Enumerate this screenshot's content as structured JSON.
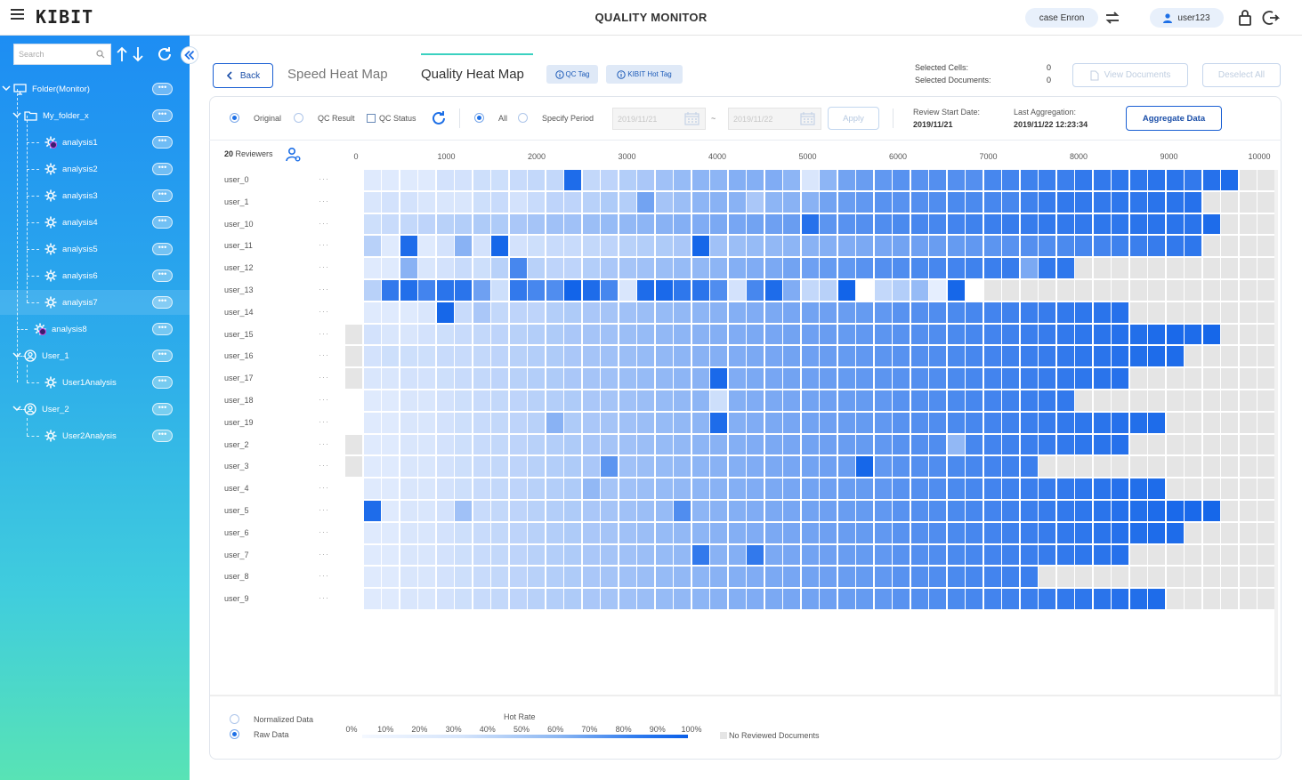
{
  "app": {
    "logo": "KIBIT",
    "title": "QUALITY MONITOR",
    "case_label": "case Enron",
    "user_label": "user123"
  },
  "sidebar": {
    "search_placeholder": "Search",
    "tree": [
      {
        "label": "Folder(Monitor)",
        "icon": "monitor-icon",
        "level": 0
      },
      {
        "label": "My_folder_x",
        "icon": "folder-icon",
        "level": 1
      },
      {
        "label": "analysis1",
        "icon": "gear-icon",
        "level": 2,
        "badge": true
      },
      {
        "label": "analysis2",
        "icon": "gear-icon",
        "level": 2
      },
      {
        "label": "analysis3",
        "icon": "gear-icon",
        "level": 2
      },
      {
        "label": "analysis4",
        "icon": "gear-icon",
        "level": 2
      },
      {
        "label": "analysis5",
        "icon": "gear-icon",
        "level": 2
      },
      {
        "label": "analysis6",
        "icon": "gear-icon",
        "level": 2
      },
      {
        "label": "analysis7",
        "icon": "gear-icon",
        "level": 2,
        "selected": true
      },
      {
        "label": "analysis8",
        "icon": "gear-icon",
        "level": 1,
        "badge": true
      },
      {
        "label": "User_1",
        "icon": "user-circle-icon",
        "level": 1
      },
      {
        "label": "User1Analysis",
        "icon": "gear-icon",
        "level": 2
      },
      {
        "label": "User_2",
        "icon": "user-circle-icon",
        "level": 1
      },
      {
        "label": "User2Analysis",
        "icon": "gear-icon",
        "level": 2
      }
    ],
    "more_label": "•••"
  },
  "header": {
    "back_label": "Back",
    "tabs": [
      "Speed Heat Map",
      "Quality Heat Map"
    ],
    "qc_tag_label": "QC Tag",
    "kibit_tag_label": "KIBIT Hot Tag",
    "selected_cells_label": "Selected Cells:",
    "selected_docs_label": "Selected Documents:",
    "selected_cells_value": "0",
    "selected_docs_value": "0",
    "view_docs_label": "View Documents",
    "deselect_label": "Deselect All"
  },
  "filters": {
    "original_label": "Original",
    "qc_result_label": "QC Result",
    "qc_status_label": "QC Status",
    "all_label": "All",
    "specify_label": "Specify Period",
    "date_from": "2019/11/21",
    "date_sep": "~",
    "date_to": "2019/11/22",
    "apply_label": "Apply",
    "review_start_label": "Review Start Date:",
    "review_start_value": "2019/11/21",
    "last_agg_label": "Last Aggregation:",
    "last_agg_value": "2019/11/22 12:23:34",
    "aggregate_label": "Aggregate Data"
  },
  "heatmap": {
    "reviewer_count": "20",
    "reviewer_label": "Reviewers",
    "row_dots": "···",
    "x_ticks": [
      "0",
      "1000",
      "2000",
      "3000",
      "4000",
      "5000",
      "6000",
      "7000",
      "8000",
      "9000",
      "10000"
    ]
  },
  "chart_data": {
    "type": "heatmap",
    "title": "",
    "xlabel": "",
    "ylabel": "",
    "x_ticks": [
      0,
      1000,
      2000,
      3000,
      4000,
      5000,
      6000,
      7000,
      8000,
      9000,
      10000
    ],
    "xlim": [
      0,
      10000
    ],
    "rows": [
      "user_0",
      "user_1",
      "user_10",
      "user_11",
      "user_12",
      "user_13",
      "user_14",
      "user_15",
      "user_16",
      "user_17",
      "user_18",
      "user_19",
      "user_2",
      "user_3",
      "user_4",
      "user_5",
      "user_6",
      "user_7",
      "user_8",
      "user_9"
    ],
    "columns": 51,
    "value_scale": "Hot Rate 0%–100%; -1 = No Reviewed Documents; 0 = empty",
    "values": [
      [
        0,
        6,
        6,
        6,
        6,
        10,
        10,
        12,
        12,
        14,
        16,
        16,
        90,
        16,
        18,
        22,
        26,
        30,
        34,
        38,
        38,
        42,
        42,
        44,
        38,
        8,
        38,
        50,
        54,
        58,
        62,
        62,
        64,
        64,
        64,
        70,
        72,
        74,
        76,
        76,
        80,
        80,
        82,
        82,
        84,
        84,
        80,
        86,
        90,
        -1,
        -1
      ],
      [
        0,
        8,
        10,
        10,
        8,
        8,
        8,
        12,
        14,
        10,
        14,
        18,
        18,
        20,
        24,
        22,
        50,
        28,
        32,
        38,
        40,
        40,
        26,
        38,
        40,
        40,
        50,
        54,
        58,
        62,
        62,
        64,
        66,
        68,
        68,
        70,
        70,
        74,
        78,
        80,
        80,
        80,
        82,
        82,
        84,
        84,
        86,
        -1,
        -1,
        -1,
        -1
      ],
      [
        0,
        12,
        14,
        16,
        18,
        20,
        22,
        24,
        24,
        26,
        28,
        30,
        30,
        32,
        34,
        36,
        38,
        40,
        42,
        44,
        46,
        48,
        50,
        52,
        54,
        86,
        60,
        62,
        64,
        66,
        68,
        70,
        70,
        72,
        74,
        76,
        78,
        78,
        80,
        80,
        80,
        82,
        82,
        84,
        84,
        84,
        84,
        90,
        -1,
        -1,
        -1
      ],
      [
        0,
        20,
        6,
        90,
        6,
        10,
        40,
        10,
        94,
        10,
        12,
        14,
        14,
        16,
        18,
        20,
        22,
        24,
        26,
        94,
        30,
        32,
        34,
        36,
        38,
        40,
        42,
        44,
        46,
        48,
        50,
        52,
        54,
        56,
        58,
        60,
        62,
        64,
        66,
        68,
        70,
        72,
        74,
        76,
        78,
        80,
        82,
        -1,
        -1,
        -1,
        -1
      ],
      [
        0,
        6,
        6,
        40,
        8,
        10,
        14,
        12,
        20,
        70,
        20,
        18,
        18,
        22,
        26,
        28,
        30,
        32,
        34,
        36,
        38,
        42,
        44,
        46,
        50,
        52,
        56,
        58,
        62,
        64,
        66,
        68,
        70,
        72,
        74,
        76,
        78,
        46,
        80,
        82,
        -1,
        -1,
        -1,
        -1,
        -1,
        -1,
        -1,
        -1,
        -1,
        -1,
        -1
      ],
      [
        0,
        20,
        80,
        88,
        72,
        84,
        84,
        52,
        12,
        80,
        70,
        66,
        96,
        90,
        70,
        8,
        90,
        92,
        82,
        84,
        66,
        10,
        70,
        90,
        44,
        16,
        20,
        96,
        0,
        16,
        22,
        34,
        4,
        94,
        0,
        -1,
        -1,
        -1,
        -1,
        -1,
        -1,
        -1,
        -1,
        -1,
        -1,
        -1,
        -1,
        -1,
        -1,
        -1,
        -1
      ],
      [
        0,
        6,
        6,
        6,
        8,
        94,
        14,
        26,
        16,
        18,
        18,
        22,
        24,
        26,
        28,
        30,
        32,
        34,
        36,
        38,
        40,
        42,
        44,
        46,
        48,
        50,
        52,
        54,
        56,
        58,
        62,
        64,
        66,
        68,
        70,
        72,
        74,
        76,
        78,
        80,
        82,
        84,
        86,
        -1,
        -1,
        -1,
        -1,
        -1,
        -1,
        -1,
        -1
      ],
      [
        -1,
        10,
        8,
        8,
        10,
        12,
        14,
        16,
        18,
        20,
        22,
        24,
        26,
        28,
        30,
        32,
        34,
        36,
        38,
        40,
        42,
        44,
        46,
        48,
        50,
        52,
        54,
        56,
        58,
        60,
        62,
        64,
        66,
        68,
        70,
        72,
        74,
        76,
        78,
        80,
        82,
        84,
        86,
        88,
        90,
        92,
        90,
        94,
        -1,
        -1,
        -1
      ],
      [
        -1,
        10,
        12,
        12,
        12,
        14,
        14,
        16,
        18,
        20,
        22,
        24,
        26,
        28,
        30,
        32,
        34,
        36,
        38,
        40,
        42,
        44,
        46,
        48,
        50,
        52,
        54,
        56,
        58,
        60,
        62,
        64,
        66,
        68,
        70,
        72,
        74,
        76,
        78,
        80,
        82,
        84,
        86,
        88,
        90,
        90,
        -1,
        -1,
        -1,
        -1,
        -1
      ],
      [
        -1,
        8,
        8,
        10,
        10,
        12,
        14,
        16,
        18,
        20,
        22,
        24,
        26,
        28,
        30,
        32,
        34,
        36,
        38,
        40,
        92,
        44,
        46,
        48,
        50,
        52,
        54,
        56,
        58,
        60,
        62,
        64,
        66,
        68,
        70,
        72,
        74,
        76,
        78,
        80,
        82,
        84,
        86,
        -1,
        -1,
        -1,
        -1,
        -1,
        -1,
        -1,
        -1
      ],
      [
        0,
        6,
        6,
        8,
        8,
        10,
        12,
        14,
        16,
        18,
        20,
        22,
        24,
        26,
        28,
        30,
        32,
        34,
        36,
        38,
        12,
        42,
        44,
        46,
        48,
        50,
        52,
        54,
        56,
        58,
        62,
        64,
        66,
        68,
        70,
        72,
        74,
        76,
        78,
        80,
        -1,
        -1,
        -1,
        -1,
        -1,
        -1,
        -1,
        -1,
        -1,
        -1,
        -1
      ],
      [
        0,
        6,
        6,
        8,
        8,
        10,
        12,
        14,
        16,
        18,
        20,
        40,
        24,
        26,
        28,
        30,
        32,
        34,
        36,
        38,
        90,
        42,
        44,
        46,
        48,
        50,
        52,
        54,
        56,
        58,
        62,
        64,
        66,
        68,
        70,
        72,
        74,
        76,
        78,
        80,
        82,
        84,
        86,
        88,
        90,
        -1,
        -1,
        -1,
        -1,
        -1,
        -1
      ],
      [
        -1,
        6,
        6,
        8,
        8,
        10,
        12,
        14,
        16,
        18,
        20,
        22,
        24,
        26,
        28,
        30,
        32,
        34,
        36,
        38,
        40,
        42,
        44,
        46,
        48,
        50,
        52,
        54,
        56,
        58,
        62,
        64,
        66,
        36,
        70,
        72,
        74,
        76,
        78,
        80,
        82,
        84,
        86,
        -1,
        -1,
        -1,
        -1,
        -1,
        -1,
        -1,
        -1
      ],
      [
        -1,
        6,
        6,
        8,
        8,
        10,
        12,
        14,
        16,
        18,
        20,
        22,
        24,
        26,
        60,
        30,
        32,
        34,
        36,
        38,
        40,
        42,
        44,
        46,
        48,
        50,
        52,
        54,
        94,
        58,
        62,
        64,
        66,
        68,
        70,
        72,
        74,
        76,
        -1,
        -1,
        -1,
        -1,
        -1,
        -1,
        -1,
        -1,
        -1,
        -1,
        -1,
        -1,
        -1
      ],
      [
        0,
        6,
        6,
        8,
        8,
        10,
        12,
        14,
        16,
        18,
        20,
        22,
        24,
        36,
        28,
        30,
        32,
        34,
        36,
        38,
        40,
        42,
        44,
        46,
        48,
        50,
        52,
        54,
        56,
        58,
        62,
        64,
        66,
        68,
        70,
        72,
        74,
        76,
        78,
        80,
        82,
        84,
        86,
        88,
        90,
        -1,
        -1,
        -1,
        -1,
        -1,
        -1
      ],
      [
        0,
        90,
        6,
        8,
        8,
        10,
        30,
        14,
        16,
        18,
        20,
        22,
        24,
        26,
        28,
        30,
        32,
        34,
        66,
        38,
        40,
        42,
        44,
        46,
        48,
        50,
        52,
        54,
        56,
        58,
        62,
        64,
        66,
        68,
        70,
        72,
        74,
        76,
        78,
        80,
        82,
        84,
        86,
        88,
        90,
        92,
        92,
        94,
        -1,
        -1,
        -1
      ],
      [
        0,
        6,
        6,
        8,
        8,
        10,
        12,
        14,
        16,
        18,
        20,
        22,
        24,
        26,
        28,
        30,
        32,
        34,
        36,
        38,
        40,
        42,
        44,
        46,
        48,
        50,
        52,
        54,
        56,
        58,
        62,
        64,
        66,
        68,
        70,
        72,
        74,
        76,
        78,
        80,
        82,
        84,
        86,
        88,
        90,
        90,
        -1,
        -1,
        -1,
        -1,
        -1
      ],
      [
        0,
        6,
        6,
        8,
        8,
        10,
        12,
        14,
        16,
        18,
        20,
        22,
        24,
        26,
        28,
        30,
        32,
        34,
        36,
        80,
        40,
        42,
        80,
        46,
        48,
        50,
        52,
        54,
        56,
        58,
        62,
        64,
        66,
        68,
        70,
        72,
        74,
        76,
        78,
        80,
        82,
        84,
        86,
        -1,
        -1,
        -1,
        -1,
        -1,
        -1,
        -1,
        -1
      ],
      [
        0,
        6,
        6,
        8,
        8,
        10,
        12,
        14,
        16,
        18,
        20,
        22,
        24,
        26,
        28,
        30,
        32,
        34,
        36,
        38,
        40,
        42,
        44,
        46,
        48,
        50,
        52,
        54,
        56,
        58,
        62,
        64,
        66,
        68,
        70,
        72,
        74,
        76,
        -1,
        -1,
        -1,
        -1,
        -1,
        -1,
        -1,
        -1,
        -1,
        -1,
        -1,
        -1,
        -1
      ],
      [
        0,
        6,
        6,
        8,
        8,
        10,
        12,
        14,
        16,
        18,
        20,
        22,
        24,
        26,
        28,
        30,
        32,
        34,
        36,
        38,
        40,
        42,
        44,
        46,
        48,
        50,
        52,
        54,
        56,
        58,
        62,
        64,
        66,
        68,
        70,
        72,
        74,
        76,
        78,
        80,
        82,
        84,
        86,
        88,
        90,
        -1,
        -1,
        -1,
        -1,
        -1,
        -1
      ]
    ]
  },
  "legend": {
    "normalized_label": "Normalized Data",
    "raw_label": "Raw Data",
    "title": "Hot Rate",
    "ticks": [
      "0%",
      "10%",
      "20%",
      "30%",
      "40%",
      "50%",
      "60%",
      "70%",
      "80%",
      "90%",
      "100%"
    ],
    "no_reviewed_label": "No Reviewed Documents"
  },
  "colors": {
    "accent": "#1a5fd3",
    "no_data": "#e5e5e5",
    "cell_low": "#f4f8ff",
    "cell_high": "#0a5fe8"
  }
}
